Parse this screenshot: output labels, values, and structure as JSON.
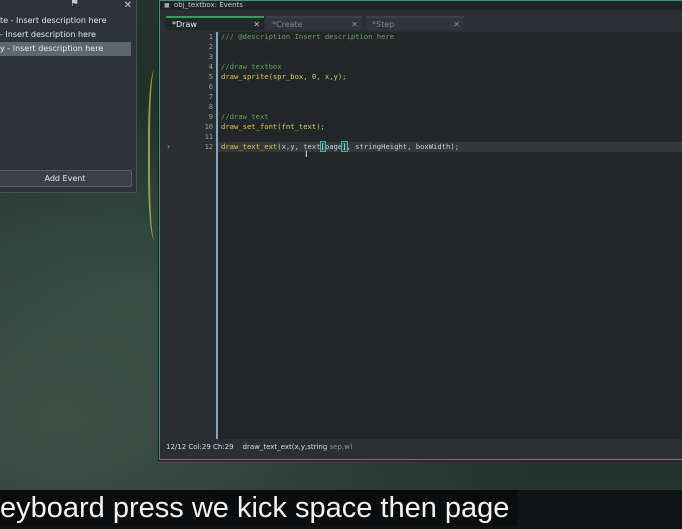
{
  "event_panel": {
    "items": [
      {
        "label": "te - Insert description here"
      },
      {
        "label": "- Insert description here"
      },
      {
        "label": "y - Insert description here"
      }
    ],
    "add_event_label": "Add Event",
    "close_icon": "close-icon",
    "flag_icon": "flag-icon"
  },
  "editor": {
    "window_title": "obj_textbox: Events",
    "tabs": [
      {
        "label": "*Draw"
      },
      {
        "label": "*Create"
      },
      {
        "label": "*Step"
      }
    ],
    "line_numbers": [
      "1",
      "2",
      "3",
      "4",
      "5",
      "6",
      "7",
      "8",
      "9",
      "10",
      "11",
      "12"
    ],
    "code": {
      "l1": "/// @description Insert description here",
      "l4": "//draw textbox",
      "l5_fn": "draw_sprite",
      "l5_args": "(spr_box, 0, x,y);",
      "l9": "//draw text",
      "l10_fn": "draw_set_font",
      "l10_args": "(fnt_text);",
      "l12_fn": "draw_text_ext",
      "l12_a": "(x,y, text",
      "l12_b": "[",
      "l12_c": "page",
      "l12_d": "]",
      "l12_e": ", stringHeight, boxWidth);"
    },
    "status": {
      "position": "12/12 Col:29 Ch:29",
      "signature": "draw_text_ext(x,y,string",
      "signature_dim": " sep,w)"
    }
  },
  "subtitle": "eyboard press we kick space then page",
  "colors": {
    "accent": "#4c8f7d",
    "comment": "#5fa25a",
    "function": "#e5c84a"
  }
}
